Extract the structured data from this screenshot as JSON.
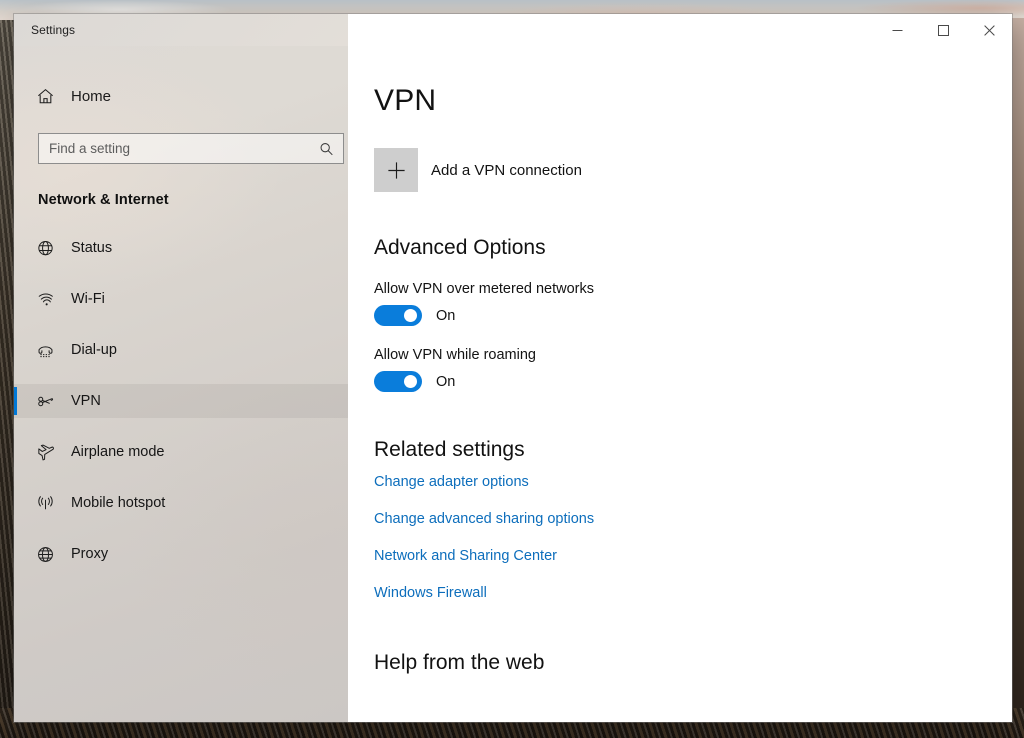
{
  "window": {
    "title": "Settings",
    "controls": {
      "minimize": "Minimize",
      "maximize": "Maximize",
      "close": "Close"
    }
  },
  "sidebar": {
    "home_label": "Home",
    "search": {
      "placeholder": "Find a setting",
      "value": "",
      "icon": "search-icon"
    },
    "category": "Network & Internet",
    "items": [
      {
        "label": "Status",
        "icon": "globe-status-icon",
        "selected": false
      },
      {
        "label": "Wi-Fi",
        "icon": "wifi-icon",
        "selected": false
      },
      {
        "label": "Dial-up",
        "icon": "dialup-phone-icon",
        "selected": false
      },
      {
        "label": "VPN",
        "icon": "vpn-key-icon",
        "selected": true
      },
      {
        "label": "Airplane mode",
        "icon": "airplane-icon",
        "selected": false
      },
      {
        "label": "Mobile hotspot",
        "icon": "hotspot-icon",
        "selected": false
      },
      {
        "label": "Proxy",
        "icon": "globe-proxy-icon",
        "selected": false
      }
    ]
  },
  "content": {
    "page_title": "VPN",
    "add_connection": {
      "label": "Add a VPN connection",
      "icon": "plus-icon"
    },
    "advanced_options": {
      "heading": "Advanced Options",
      "toggles": [
        {
          "label": "Allow VPN over metered networks",
          "state": "On",
          "on": true
        },
        {
          "label": "Allow VPN while roaming",
          "state": "On",
          "on": true
        }
      ]
    },
    "related_settings": {
      "heading": "Related settings",
      "links": [
        "Change adapter options",
        "Change advanced sharing options",
        "Network and Sharing Center",
        "Windows Firewall"
      ]
    },
    "help_section": {
      "heading": "Help from the web"
    }
  },
  "colors": {
    "accent": "#0a7ddb",
    "selection_bar": "#0078d7",
    "link": "#0d6ebc",
    "sidebar_bg": "#d9d4ce",
    "content_bg": "#ffffff"
  }
}
